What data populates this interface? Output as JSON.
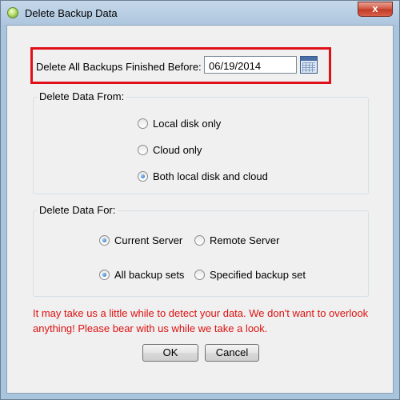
{
  "window": {
    "title": "Delete Backup Data",
    "icon": "app-icon",
    "close_label": "x"
  },
  "date_filter": {
    "label": "Delete All Backups Finished Before:",
    "value": "06/19/2014",
    "icon": "calendar-icon",
    "highlight_color": "#e0101a"
  },
  "delete_from": {
    "legend": "Delete Data From:",
    "options": [
      {
        "label": "Local disk only",
        "checked": false
      },
      {
        "label": "Cloud only",
        "checked": false
      },
      {
        "label": "Both local disk and cloud",
        "checked": true
      }
    ]
  },
  "delete_for": {
    "legend": "Delete Data For:",
    "server_options": [
      {
        "label": "Current Server",
        "checked": true
      },
      {
        "label": "Remote Server",
        "checked": false
      }
    ],
    "backup_set_options": [
      {
        "label": "All backup sets",
        "checked": true
      },
      {
        "label": "Specified backup set",
        "checked": false
      }
    ]
  },
  "warning": {
    "text": "It may take us a little while to detect your data. We don't want to overlook anything! Please bear with us while we take a look.",
    "color": "#dd1111"
  },
  "buttons": {
    "ok": "OK",
    "cancel": "Cancel"
  }
}
